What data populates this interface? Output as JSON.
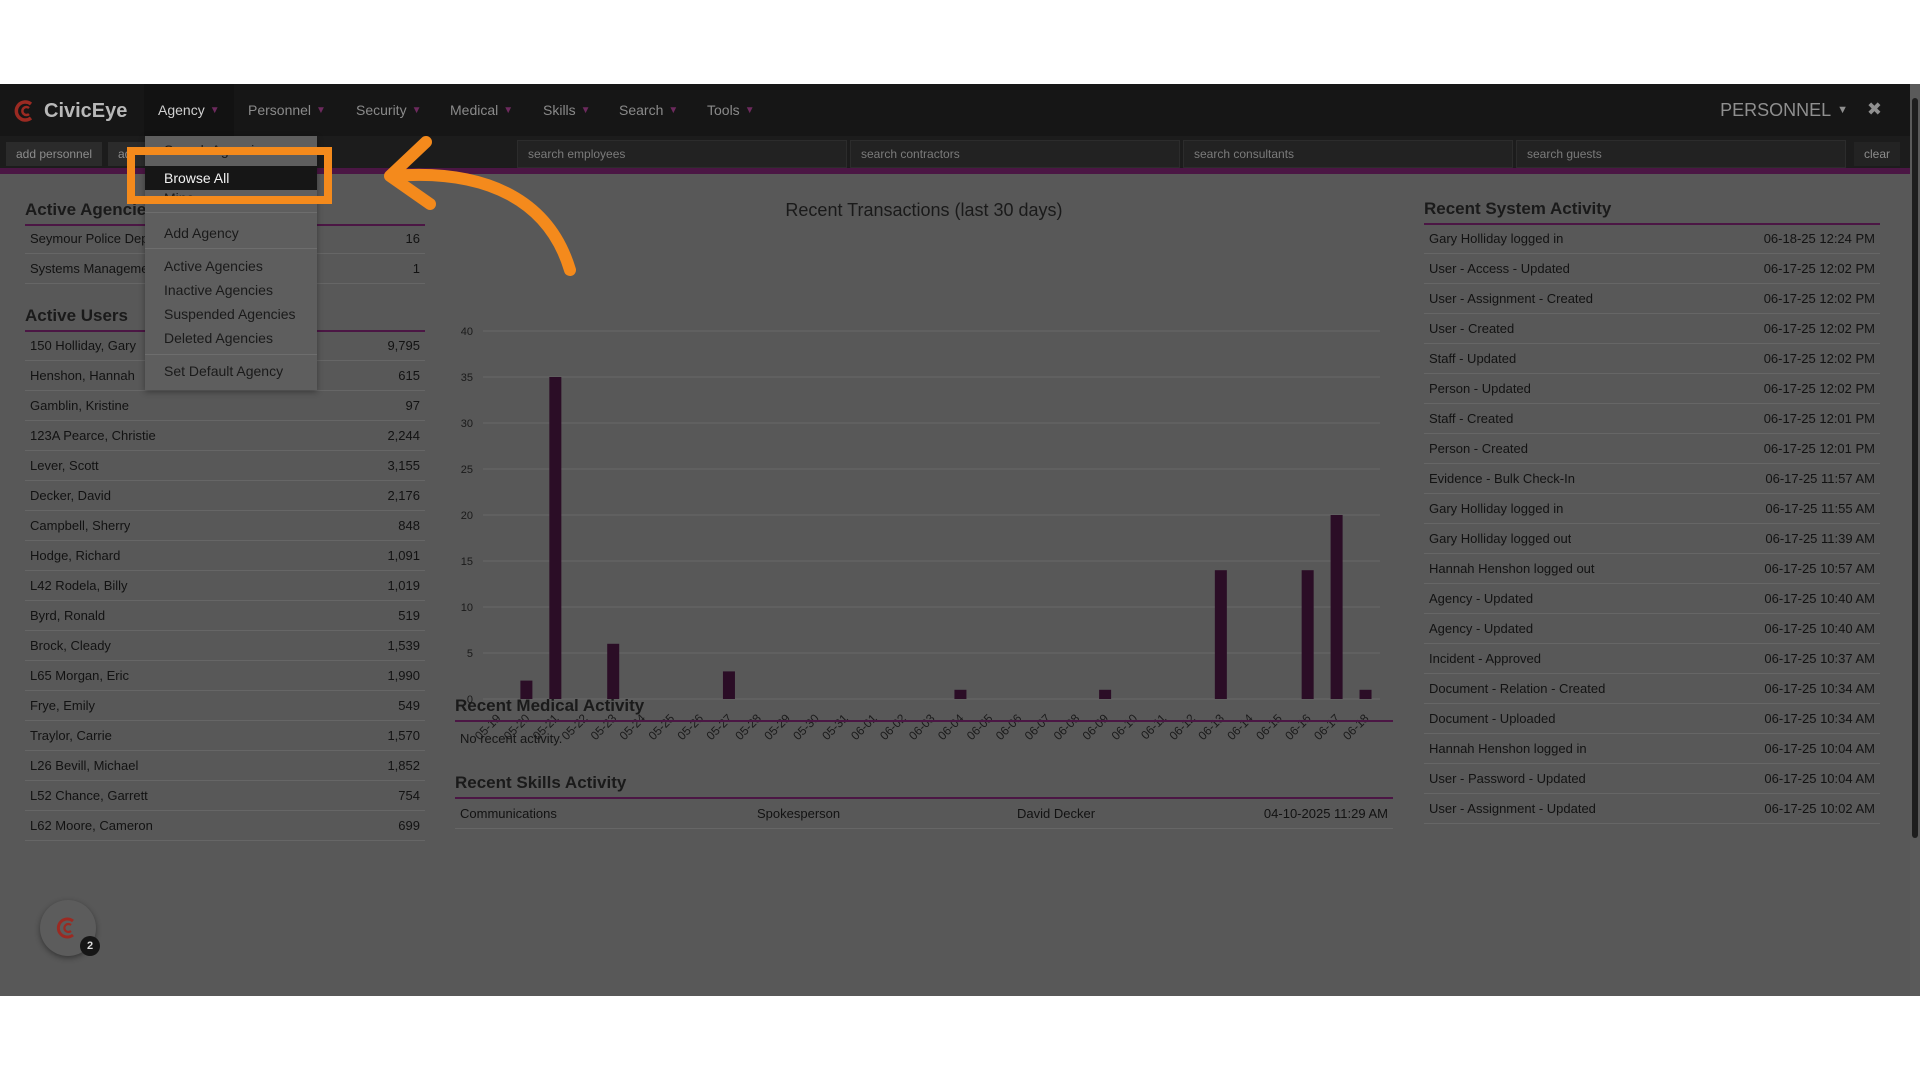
{
  "brand": {
    "name": "CivicEye",
    "accent": "#4b1644",
    "logo_red": "#c0392b"
  },
  "nav": {
    "menus": [
      {
        "label": "Agency"
      },
      {
        "label": "Personnel"
      },
      {
        "label": "Security"
      },
      {
        "label": "Medical"
      },
      {
        "label": "Skills"
      },
      {
        "label": "Search"
      },
      {
        "label": "Tools"
      }
    ],
    "right_menu": "PERSONNEL"
  },
  "searchbar": {
    "add_personnel": "add personnel",
    "add_partial": "ad",
    "employees_placeholder": "search employees",
    "contractors_placeholder": "search contractors",
    "consultants_placeholder": "search consultants",
    "guests_placeholder": "search guests",
    "clear": "clear"
  },
  "dropdown": {
    "search_agencies": "Search Agencies",
    "browse_all": "Browse All",
    "mine": "Mine",
    "add_agency": "Add Agency",
    "active_agencies": "Active Agencies",
    "inactive_agencies": "Inactive Agencies",
    "suspended_agencies": "Suspended Agencies",
    "deleted_agencies": "Deleted Agencies",
    "set_default": "Set Default Agency"
  },
  "active_agencies": {
    "title": "Active Agencies",
    "rows": [
      {
        "name": "Seymour Police Department",
        "count": "16"
      },
      {
        "name": "Systems Management",
        "count": "1"
      }
    ]
  },
  "active_users": {
    "title": "Active Users",
    "rows": [
      {
        "name": "150 Holliday, Gary",
        "count": "9,795"
      },
      {
        "name": "Henshon, Hannah",
        "count": "615"
      },
      {
        "name": "Gamblin, Kristine",
        "count": "97"
      },
      {
        "name": "123A Pearce, Christie",
        "count": "2,244"
      },
      {
        "name": "Lever, Scott",
        "count": "3,155"
      },
      {
        "name": "Decker, David",
        "count": "2,176"
      },
      {
        "name": "Campbell, Sherry",
        "count": "848"
      },
      {
        "name": "Hodge, Richard",
        "count": "1,091"
      },
      {
        "name": "L42 Rodela, Billy",
        "count": "1,019"
      },
      {
        "name": "Byrd, Ronald",
        "count": "519"
      },
      {
        "name": "Brock, Cleady",
        "count": "1,539"
      },
      {
        "name": "L65 Morgan, Eric",
        "count": "1,990"
      },
      {
        "name": "Frye, Emily",
        "count": "549"
      },
      {
        "name": "Traylor, Carrie",
        "count": "1,570"
      },
      {
        "name": "L26 Bevill, Michael",
        "count": "1,852"
      },
      {
        "name": "L52 Chance, Garrett",
        "count": "754"
      },
      {
        "name": "L62 Moore, Cameron",
        "count": "699"
      }
    ]
  },
  "chart_data": {
    "type": "bar",
    "title": "Recent Transactions (last 30 days)",
    "categories": [
      "05-19",
      "05-20",
      "05-21",
      "05-22",
      "05-23",
      "05-24",
      "05-25",
      "05-26",
      "05-27",
      "05-28",
      "05-29",
      "05-30",
      "05-31",
      "06-01",
      "06-02",
      "06-03",
      "06-04",
      "06-05",
      "06-06",
      "06-07",
      "06-08",
      "06-09",
      "06-10",
      "06-11",
      "06-12",
      "06-13",
      "06-14",
      "06-15",
      "06-16",
      "06-17",
      "06-18"
    ],
    "values": [
      0,
      2,
      35,
      0,
      6,
      0,
      0,
      0,
      3,
      0,
      0,
      0,
      0,
      0,
      0,
      0,
      1,
      0,
      0,
      0,
      0,
      1,
      0,
      0,
      0,
      14,
      0,
      0,
      14,
      20,
      1
    ],
    "ylim": [
      0,
      40
    ],
    "yticks": [
      "0",
      "5",
      "10",
      "15",
      "20",
      "25",
      "30",
      "35",
      "40"
    ],
    "bar_color": "#2b0d26",
    "grid": true
  },
  "medical": {
    "title": "Recent Medical Activity",
    "empty": "No recent activity."
  },
  "skills": {
    "title": "Recent Skills Activity",
    "row": {
      "skill": "Communications",
      "role": "Spokesperson",
      "person": "David Decker",
      "date": "04-10-2025 11:29 AM"
    }
  },
  "system": {
    "title": "Recent System Activity",
    "rows": [
      {
        "event": "Gary Holliday logged in",
        "time": "06-18-25 12:24 PM"
      },
      {
        "event": "User - Access - Updated",
        "time": "06-17-25 12:02 PM"
      },
      {
        "event": "User - Assignment - Created",
        "time": "06-17-25 12:02 PM"
      },
      {
        "event": "User - Created",
        "time": "06-17-25 12:02 PM"
      },
      {
        "event": "Staff - Updated",
        "time": "06-17-25 12:02 PM"
      },
      {
        "event": "Person - Updated",
        "time": "06-17-25 12:02 PM"
      },
      {
        "event": "Staff - Created",
        "time": "06-17-25 12:01 PM"
      },
      {
        "event": "Person - Created",
        "time": "06-17-25 12:01 PM"
      },
      {
        "event": "Evidence - Bulk Check-In",
        "time": "06-17-25 11:57 AM"
      },
      {
        "event": "Gary Holliday logged in",
        "time": "06-17-25 11:55 AM"
      },
      {
        "event": "Gary Holliday logged out",
        "time": "06-17-25 11:39 AM"
      },
      {
        "event": "Hannah Henshon logged out",
        "time": "06-17-25 10:57 AM"
      },
      {
        "event": "Agency - Updated",
        "time": "06-17-25 10:40 AM"
      },
      {
        "event": "Agency - Updated",
        "time": "06-17-25 10:40 AM"
      },
      {
        "event": "Incident - Approved",
        "time": "06-17-25 10:37 AM"
      },
      {
        "event": "Document - Relation - Created",
        "time": "06-17-25 10:34 AM"
      },
      {
        "event": "Document - Uploaded",
        "time": "06-17-25 10:34 AM"
      },
      {
        "event": "Hannah Henshon logged in",
        "time": "06-17-25 10:04 AM"
      },
      {
        "event": "User - Password - Updated",
        "time": "06-17-25 10:04 AM"
      },
      {
        "event": "User - Assignment - Updated",
        "time": "06-17-25 10:02 AM"
      }
    ]
  },
  "fab": {
    "badge": "2"
  },
  "annotation": {
    "color": "#f48a1c"
  }
}
